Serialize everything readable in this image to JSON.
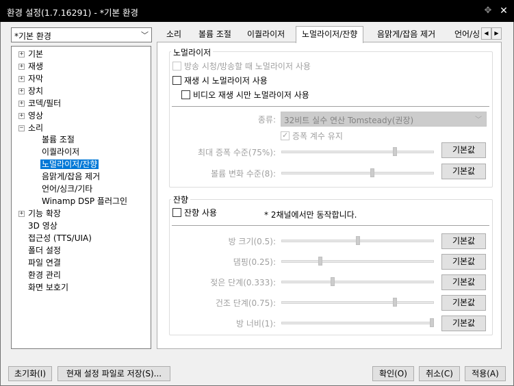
{
  "window": {
    "title": "환경 설정(1.7.16291) - *기본 환경",
    "pin_icon": "pin-icon",
    "close_icon": "close-icon"
  },
  "preset": {
    "value": "*기본 환경"
  },
  "tree": {
    "items": [
      {
        "label": "기본",
        "expander": "+"
      },
      {
        "label": "재생",
        "expander": "+"
      },
      {
        "label": "자막",
        "expander": "+"
      },
      {
        "label": "장치",
        "expander": "+"
      },
      {
        "label": "코덱/필터",
        "expander": "+"
      },
      {
        "label": "영상",
        "expander": "+"
      },
      {
        "label": "소리",
        "expander": "−"
      },
      {
        "label": "볼륨 조절"
      },
      {
        "label": "이퀄라이저"
      },
      {
        "label": "노멀라이저/잔향"
      },
      {
        "label": "음맑게/잡음 제거"
      },
      {
        "label": "언어/싱크/기타"
      },
      {
        "label": "Winamp DSP 플러그인"
      },
      {
        "label": "기능 확장",
        "expander": "+"
      },
      {
        "label": "3D 영상"
      },
      {
        "label": "접근성 (TTS/UIA)"
      },
      {
        "label": "폴더 설정"
      },
      {
        "label": "파일 연결"
      },
      {
        "label": "환경 관리"
      },
      {
        "label": "화면 보호기"
      }
    ],
    "selected": "노멀라이저/잔향"
  },
  "tabs": [
    "소리",
    "볼륨 조절",
    "이퀄라이저",
    "노멀라이저/잔향",
    "음맑게/잡음 제거",
    "언어/싱"
  ],
  "tab_scroll": {
    "left": "◀",
    "right": "▶"
  },
  "normalizer": {
    "group_title": "노멀라이저",
    "cb_broadcast": "방송 시청/방송할 때 노멀라이저 사용",
    "cb_playback": "재생 시 노멀라이저 사용",
    "cb_video_only": "비디오 재생 시만 노멀라이저 사용",
    "type_label": "종류:",
    "type_value": "32비트 실수 연산 Tomsteady(권장)",
    "cb_keep_gain": "증폭 계수 유지",
    "keep_gain_checked": true,
    "max_gain_label": "최대 증폭 수준(75%):",
    "max_gain_level": 0.75,
    "volume_change_label": "볼륨 변화 수준(8):",
    "volume_change_level": 0.6,
    "default_label": "기본값"
  },
  "reverb": {
    "group_title": "잔향",
    "cb_use": "잔향 사용",
    "note": "* 2채널에서만 동작합니다.",
    "room_size_label": "방 크기(0.5):",
    "room_size_level": 0.5,
    "damping_label": "댐핑(0.25):",
    "damping_level": 0.25,
    "wet_label": "젖은 단계(0.333):",
    "wet_level": 0.333,
    "dry_label": "건조 단계(0.75):",
    "dry_level": 0.75,
    "width_label": "방 너비(1):",
    "width_level": 1.0,
    "default_label": "기본값"
  },
  "footer": {
    "reset": "초기화(I)",
    "save": "현재 설정 파일로 저장(S)...",
    "ok": "확인(O)",
    "cancel": "취소(C)",
    "apply": "적용(A)"
  }
}
